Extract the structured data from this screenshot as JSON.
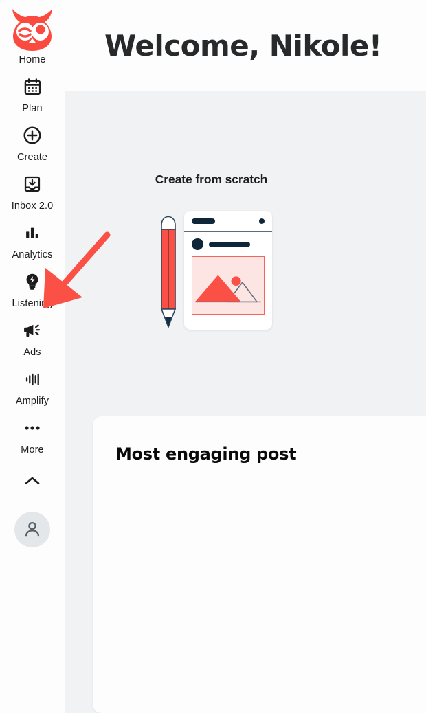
{
  "brand": {
    "name": "Hootsuite",
    "logo_icon": "owl-logo-icon",
    "accent_red": "#ff4f45",
    "dark_navy": "#0e2637",
    "page_bg": "#f1f2f4",
    "surface": "#fdfdfd"
  },
  "sidebar": {
    "items": [
      {
        "id": "home",
        "label": "Home",
        "icon": "owl-logo-icon"
      },
      {
        "id": "plan",
        "label": "Plan",
        "icon": "calendar-icon"
      },
      {
        "id": "create",
        "label": "Create",
        "icon": "plus-circle-icon"
      },
      {
        "id": "inbox",
        "label": "Inbox 2.0",
        "icon": "inbox-download-icon"
      },
      {
        "id": "analytics",
        "label": "Analytics",
        "icon": "bar-chart-icon"
      },
      {
        "id": "listening",
        "label": "Listening",
        "icon": "lightbulb-bolt-icon"
      },
      {
        "id": "ads",
        "label": "Ads",
        "icon": "megaphone-icon"
      },
      {
        "id": "amplify",
        "label": "Amplify",
        "icon": "sound-wave-icon"
      },
      {
        "id": "more",
        "label": "More",
        "icon": "ellipsis-icon"
      }
    ],
    "collapse_icon": "chevron-up-icon",
    "avatar_icon": "user-avatar-icon"
  },
  "header": {
    "title": "Welcome, Nikole!"
  },
  "main": {
    "create_from_scratch": {
      "title": "Create from scratch",
      "illustration": "pencil-and-post-composer-illustration"
    },
    "engaging_post": {
      "title": "Most engaging post"
    }
  },
  "annotation": {
    "arrow_icon": "red-pointer-arrow",
    "arrow_color": "#fb5046",
    "points_to": "Analytics"
  }
}
